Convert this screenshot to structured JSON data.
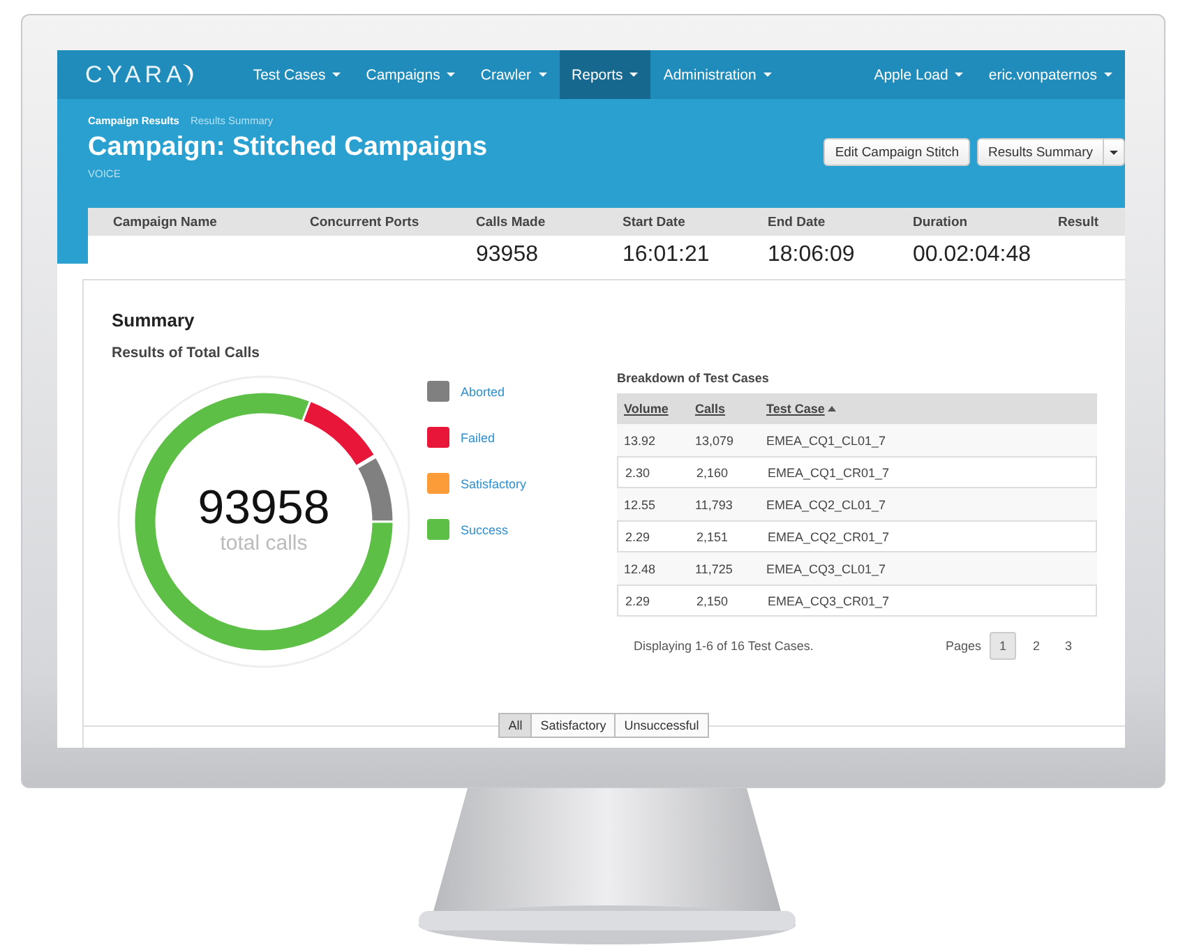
{
  "navbar": {
    "brand": "CYARA",
    "items": [
      {
        "label": "Test Cases",
        "selected": false
      },
      {
        "label": "Campaigns",
        "selected": false
      },
      {
        "label": "Crawler",
        "selected": false
      },
      {
        "label": "Reports",
        "selected": true
      },
      {
        "label": "Administration",
        "selected": false
      }
    ],
    "right_items": [
      {
        "label": "Apple Load"
      },
      {
        "label": "eric.vonpaternos"
      }
    ]
  },
  "breadcrumb": [
    {
      "label": "Campaign Results",
      "current": false
    },
    {
      "label": "Results Summary",
      "current": true
    }
  ],
  "page_title": "Campaign: Stitched Campaigns",
  "page_subtitle": "VOICE",
  "header_buttons": [
    {
      "label": "Edit Campaign Stitch"
    },
    {
      "label": "Results Summary",
      "dropdown": true
    }
  ],
  "stats": [
    {
      "label": "Campaign Name"
    },
    {
      "label": "Concurrent Ports"
    },
    {
      "label": "Calls Made",
      "value": "93958"
    },
    {
      "label": "Start Date",
      "value": "16:01:21"
    },
    {
      "label": "End Date",
      "value": "18:06:09"
    },
    {
      "label": "Duration",
      "value": "00.02:04:48"
    },
    {
      "label": "Result"
    }
  ],
  "summary": {
    "title": "Summary",
    "subtitle": "Results of Total Calls",
    "total": "93958",
    "total_label": "total calls",
    "legend": [
      {
        "label": "Aborted",
        "color": "#808080"
      },
      {
        "label": "Failed",
        "color": "#e8173a"
      },
      {
        "label": "Satisfactory",
        "color": "#fb9c38"
      },
      {
        "label": "Success",
        "color": "#5dbf45"
      }
    ]
  },
  "breakdown": {
    "title": "Breakdown of Test Cases",
    "columns": [
      {
        "label": "Volume",
        "sorted": false
      },
      {
        "label": "Calls",
        "sorted": false
      },
      {
        "label": "Test Case",
        "sorted": true
      }
    ],
    "rows": [
      [
        "13.92",
        "13,079",
        "EMEA_CQ1_CL01_7"
      ],
      [
        "2.30",
        "2,160",
        "EMEA_CQ1_CR01_7"
      ],
      [
        "12.55",
        "11,793",
        "EMEA_CQ2_CL01_7"
      ],
      [
        "2.29",
        "2,151",
        "EMEA_CQ2_CR01_7"
      ],
      [
        "12.48",
        "11,725",
        "EMEA_CQ3_CL01_7"
      ],
      [
        "2.29",
        "2,150",
        "EMEA_CQ3_CR01_7"
      ]
    ],
    "footer": "Displaying 1-6 of 16 Test Cases.",
    "pages_label": "Pages",
    "pages": [
      {
        "label": "1",
        "selected": true
      },
      {
        "label": "2",
        "selected": false
      },
      {
        "label": "3",
        "selected": false
      }
    ]
  },
  "filters": [
    {
      "label": "All",
      "selected": true
    },
    {
      "label": "Satisfactory",
      "selected": false
    },
    {
      "label": "Unsuccessful",
      "selected": false
    }
  ]
}
